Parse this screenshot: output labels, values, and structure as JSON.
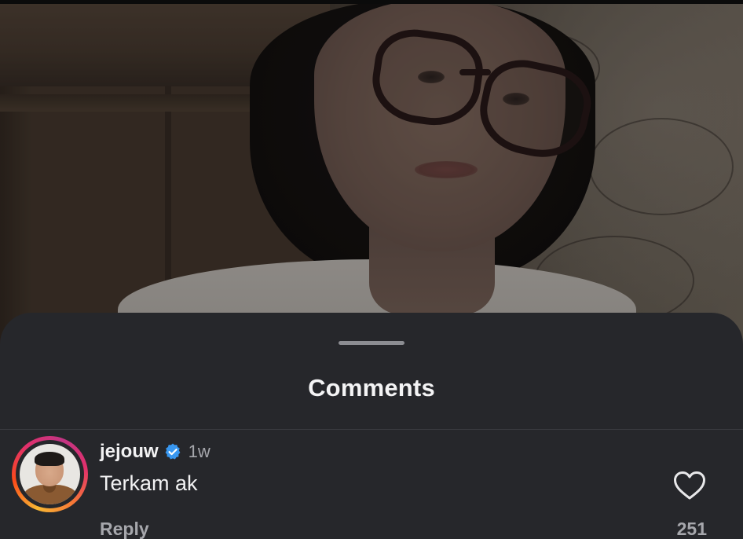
{
  "sheet": {
    "title": "Comments"
  },
  "comment": {
    "username": "jejouw",
    "verified": true,
    "timestamp": "1w",
    "text": "Terkam ak",
    "reply_label": "Reply",
    "like_count": "251"
  },
  "icons": {
    "verified": "verified-badge-icon",
    "like": "heart-outline-icon"
  },
  "colors": {
    "sheet_background": "#26272b",
    "verified_blue": "#3897f0",
    "primary_text": "#f2f2f3",
    "secondary_text": "#a6a7ac"
  }
}
